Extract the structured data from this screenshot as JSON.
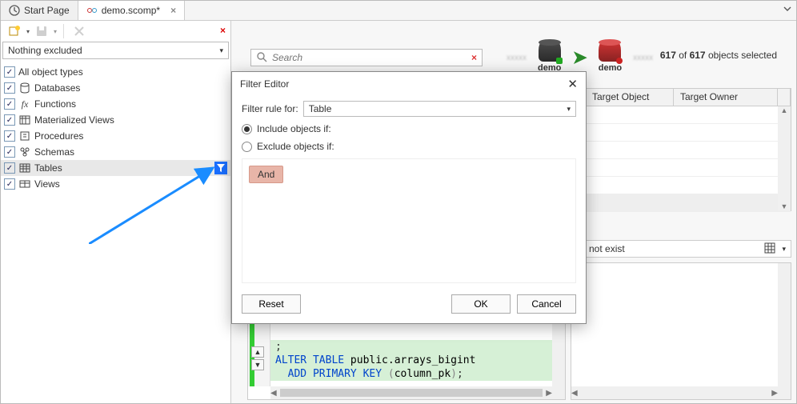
{
  "tabs": {
    "start": "Start Page",
    "demo": "demo.scomp*"
  },
  "sidebar": {
    "filter_combo": "Nothing excluded",
    "items": [
      {
        "label": "All object types",
        "icon": ""
      },
      {
        "label": "Databases",
        "icon": "db"
      },
      {
        "label": "Functions",
        "icon": "fx"
      },
      {
        "label": "Materialized Views",
        "icon": "mview"
      },
      {
        "label": "Procedures",
        "icon": "proc"
      },
      {
        "label": "Schemas",
        "icon": "schema"
      },
      {
        "label": "Tables",
        "icon": "table"
      },
      {
        "label": "Views",
        "icon": "view"
      }
    ]
  },
  "search": {
    "placeholder": "Search"
  },
  "compare": {
    "left_label": "demo",
    "right_label": "demo"
  },
  "status": {
    "count": "617",
    "total": "617",
    "suffix": "objects selected"
  },
  "table": {
    "cols": [
      "Target Object",
      "Target Owner"
    ]
  },
  "notexist": "not exist",
  "code": {
    "line1": ";",
    "alter": "ALTER TABLE",
    "table_ref": "public.arrays_bigint",
    "add": "ADD PRIMARY KEY",
    "col": "column_pk",
    "semi": ";"
  },
  "dialog": {
    "title": "Filter Editor",
    "rule_for_label": "Filter rule for:",
    "rule_for_value": "Table",
    "include_label": "Include objects if:",
    "exclude_label": "Exclude objects if:",
    "and_label": "And",
    "reset": "Reset",
    "ok": "OK",
    "cancel": "Cancel"
  }
}
